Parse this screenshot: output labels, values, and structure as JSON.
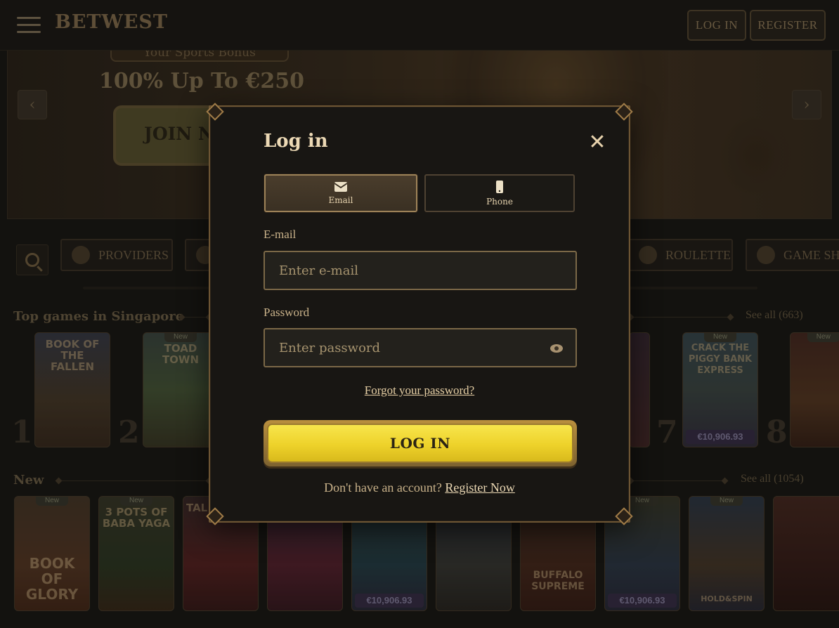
{
  "header": {
    "logo": "BETWEST",
    "login_label": "LOG IN",
    "register_label": "REGISTER"
  },
  "banner": {
    "subtitle": "Your Sports Bonus",
    "headline": "100% Up To €250",
    "cta": "JOIN N",
    "prev": "‹",
    "next": "›"
  },
  "categories": [
    {
      "label": "PROVIDERS"
    },
    {
      "label": ""
    },
    {
      "label": "ROULETTE"
    },
    {
      "label": "GAME SHO"
    }
  ],
  "top_games": {
    "title": "Top games in Singapore",
    "see_all": "See all (663)",
    "items": [
      {
        "rank": "1",
        "name": "BOOK OF THE FALLEN",
        "new": "",
        "jackpot": ""
      },
      {
        "rank": "2",
        "name": "TOAD TOWN",
        "new": "New",
        "jackpot": ""
      },
      {
        "rank": "7",
        "name": "CRACK THE PIGGY BANK EXPRESS",
        "new": "New",
        "jackpot": "€10,906.93"
      },
      {
        "rank": "8",
        "name": "",
        "new": "New",
        "jackpot": ""
      }
    ]
  },
  "new_games": {
    "title": "New",
    "see_all": "See all (1054)",
    "items": [
      {
        "name": "BOOK OF GLORY",
        "new": "New",
        "jackpot": ""
      },
      {
        "name": "3 POTS OF BABA YAGA",
        "new": "New",
        "jackpot": ""
      },
      {
        "name": "TAL",
        "new": "",
        "jackpot": ""
      },
      {
        "name": "",
        "new": "",
        "jackpot": ""
      },
      {
        "name": "",
        "new": "",
        "jackpot": "€10,906.93"
      },
      {
        "name": "",
        "new": "",
        "jackpot": ""
      },
      {
        "name": "BUFFALO SUPREME",
        "new": "",
        "jackpot": ""
      },
      {
        "name": "",
        "new": "New",
        "jackpot": "€10,906.93"
      },
      {
        "name": "HOLD&SPIN",
        "new": "New",
        "jackpot": ""
      },
      {
        "name": "",
        "new": "",
        "jackpot": ""
      }
    ]
  },
  "modal": {
    "title": "Log in",
    "close": "✕",
    "tabs": [
      {
        "label": "Email",
        "icon": "envelope-icon"
      },
      {
        "label": "Phone",
        "icon": "phone-icon"
      }
    ],
    "email_label": "E-mail",
    "email_placeholder": "Enter e-mail",
    "email_value": "",
    "password_label": "Password",
    "password_placeholder": "Enter password",
    "password_value": "",
    "forgot": "Forgot your password?",
    "submit": "LOG IN",
    "signup_prompt": "Don't have an account?",
    "signup_link": "Register Now"
  },
  "colors": {
    "accent_gold": "#f2d938",
    "frame_bronze": "#9d8258",
    "background": "#1a1714"
  }
}
